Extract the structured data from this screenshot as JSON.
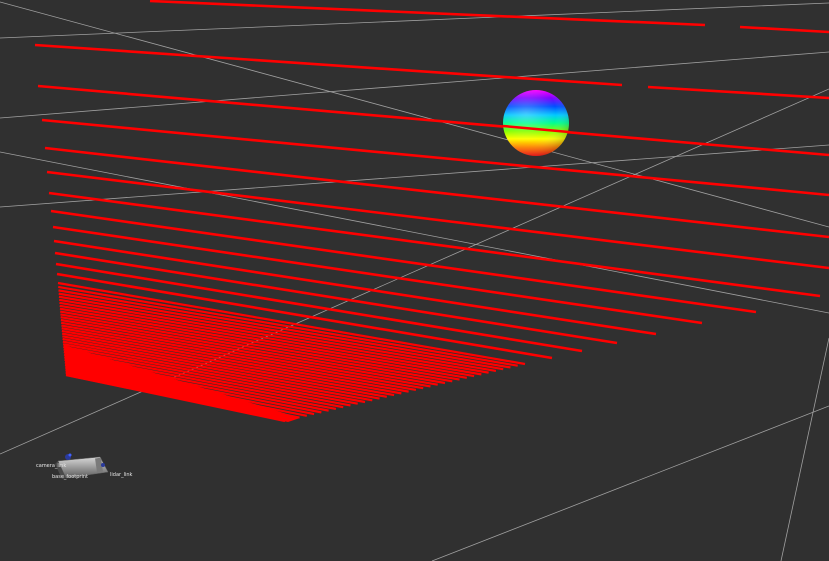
{
  "viewer": {
    "background_color": "#303030",
    "grid_color": "#a0a0a0",
    "scan_color": "#ff0000",
    "sphere_colormap": [
      "#ff00ff",
      "#8000ff",
      "#0040ff",
      "#00c0ff",
      "#00ff80",
      "#80ff00",
      "#ffff00",
      "#ff8000",
      "#ff0000"
    ],
    "robot_model_labels": [
      {
        "text": "camera_link"
      },
      {
        "text": "base_footprint"
      },
      {
        "text": "lidar_link"
      }
    ]
  }
}
